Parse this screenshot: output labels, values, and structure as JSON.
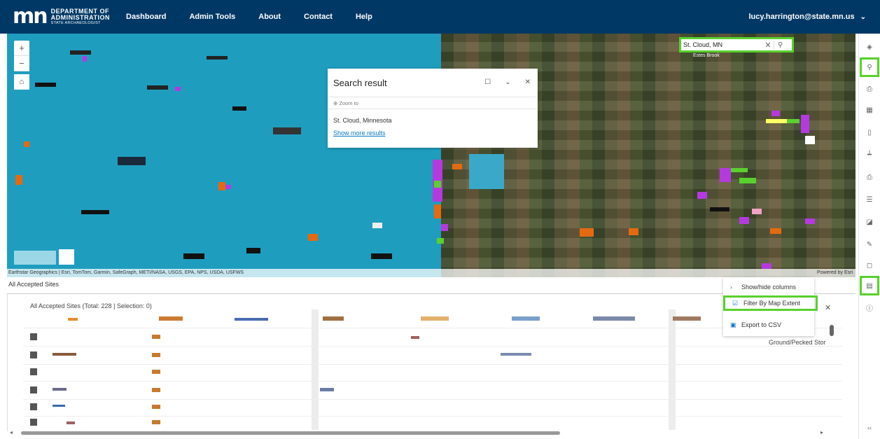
{
  "header": {
    "logo_mn": "mn",
    "logo_line1": "DEPARTMENT OF",
    "logo_line2": "ADMINISTRATION",
    "logo_line3": "STATE ARCHAEOLOGIST",
    "nav": [
      "Dashboard",
      "Admin Tools",
      "About",
      "Contact",
      "Help"
    ],
    "user": "lucy.harrington@state.mn.us",
    "user_chevron": "⌄"
  },
  "map": {
    "zoom_in": "+",
    "zoom_out": "−",
    "home_icon": "⌂",
    "attribution": "Earthstar Geographics | Esri, TomTom, Garmin, SafeGraph, METI/NASA, USGS, EPA, NPS, USDA, USFWS",
    "powered": "Powered by Esri",
    "place_label": "Estes Brook"
  },
  "search": {
    "value": "St. Cloud, MN",
    "clear": "✕",
    "search_icon": "⚲"
  },
  "popup": {
    "title": "Search result",
    "zoom_to": "⊕ Zoom to",
    "city": "St. Cloud, Minnesota",
    "more": "Show more results",
    "icon_expand": "☐",
    "icon_collapse": "⌄",
    "icon_close": "✕"
  },
  "toolbar": {
    "icons": [
      "layers-icon",
      "search-icon",
      "basemap-icon",
      "grid-icon",
      "bookmark-icon",
      "measure-icon",
      "print-icon",
      "list-icon",
      "edit-icon",
      "pencil-icon",
      "comment-icon",
      "table-icon",
      "info-icon",
      "collapse-icon"
    ],
    "glyphs": [
      "◈",
      "⚲",
      "⎙",
      "▦",
      "▯",
      "┷",
      "⎙",
      "☰",
      "◪",
      "✎",
      "◻",
      "▤",
      "ⓘ",
      "‹‹"
    ]
  },
  "panel": {
    "tab": "All Accepted Sites",
    "title": "All Accepted Sites (Total: 228 | Selection: 0)",
    "cell_visible": "Ground/Pecked Stor",
    "close": "✕",
    "scroll_left": "◂",
    "scroll_right": "▸"
  },
  "menu": {
    "items": [
      {
        "icon": "›",
        "label": "Show/hide columns"
      },
      {
        "icon": "☑",
        "label": "Filter By Map Extent"
      },
      {
        "icon": "▣",
        "label": "Export to CSV"
      }
    ]
  }
}
